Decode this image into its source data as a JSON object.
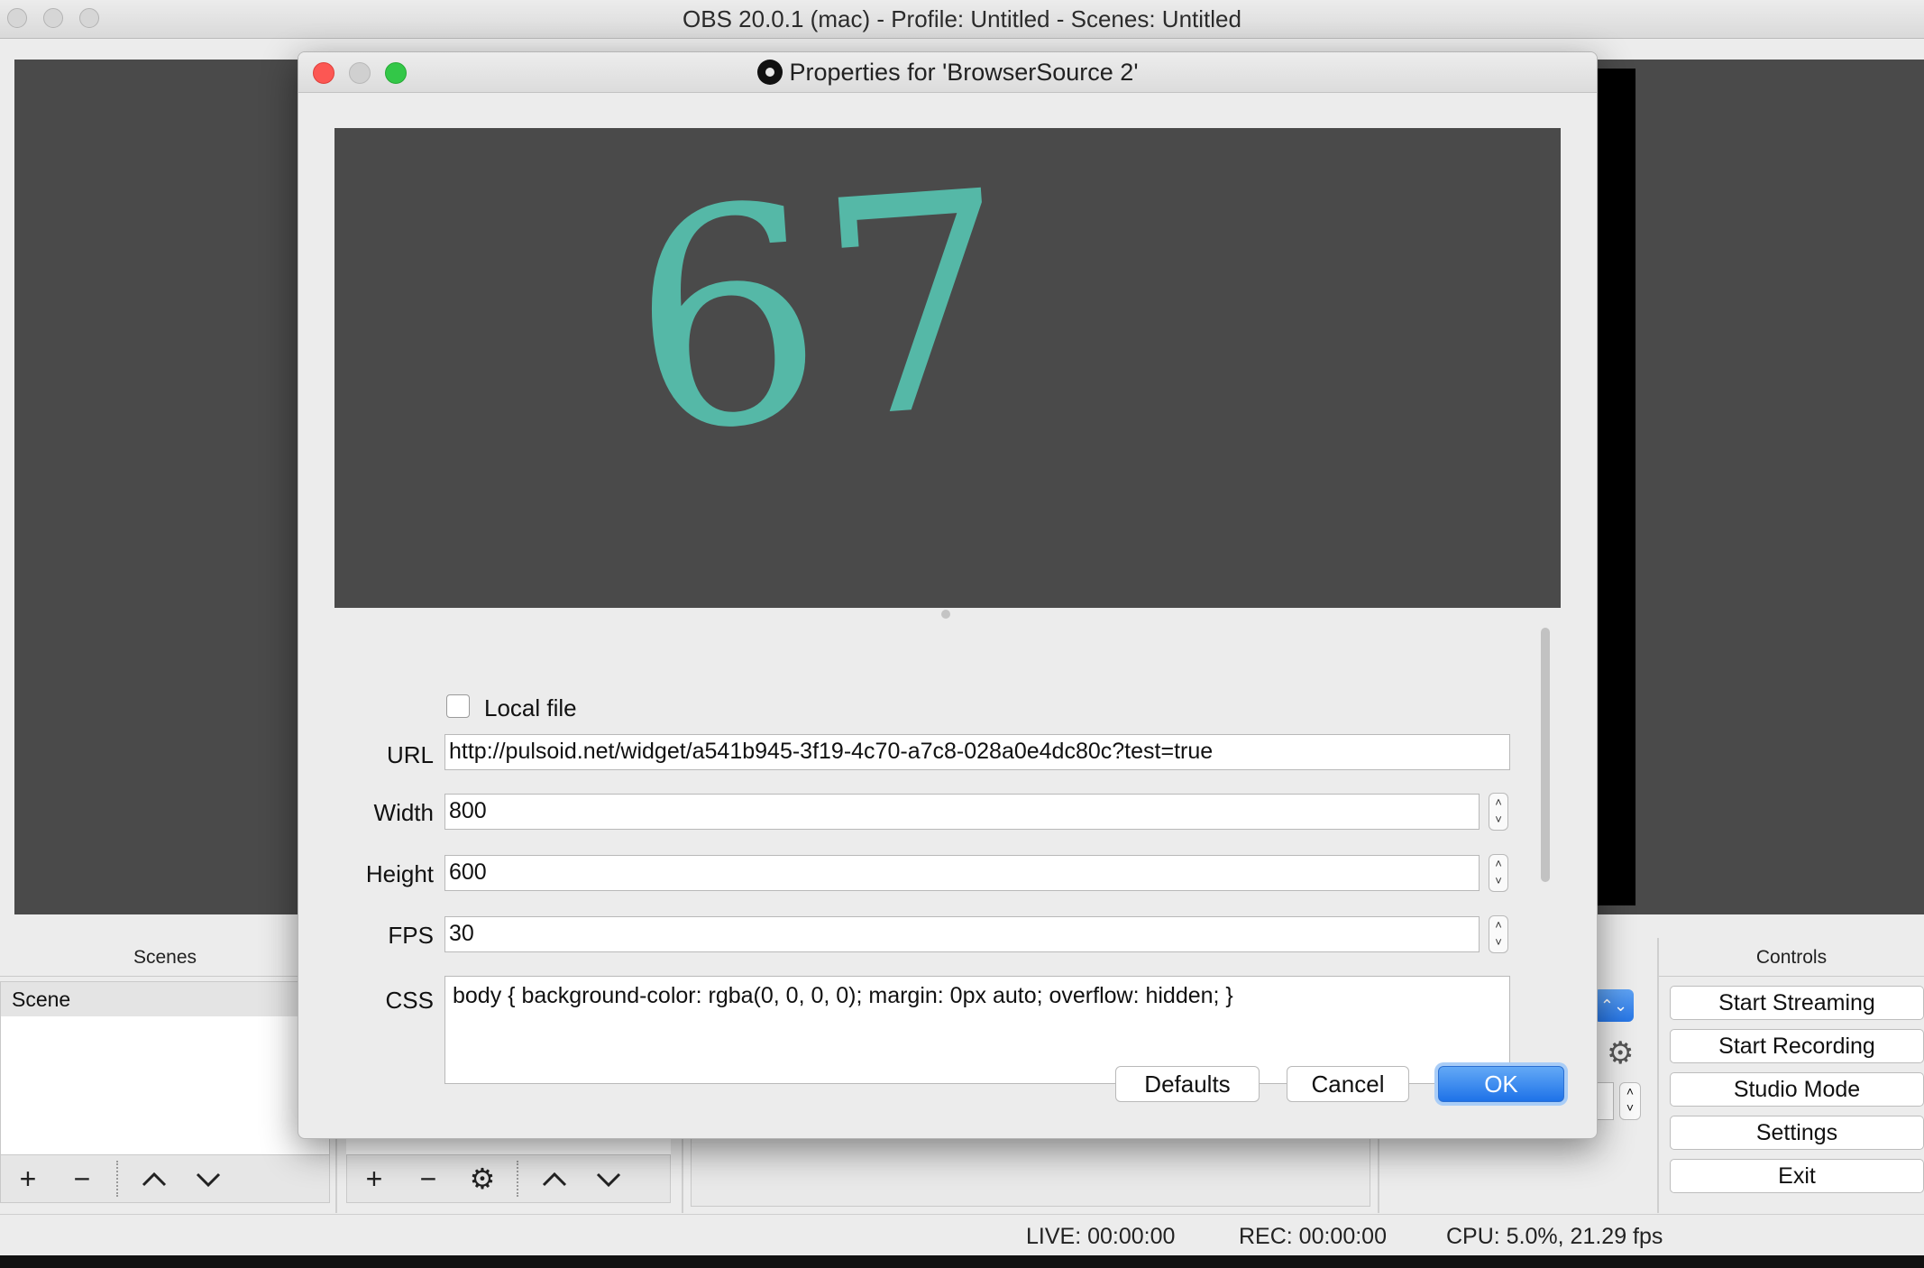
{
  "main_window": {
    "title": "OBS 20.0.1 (mac) - Profile: Untitled - Scenes: Untitled"
  },
  "docks": {
    "scenes": {
      "header": "Scenes",
      "items": [
        "Scene"
      ]
    },
    "controls": {
      "header": "Controls",
      "buttons": [
        "Start Streaming",
        "Start Recording",
        "Studio Mode",
        "Settings",
        "Exit"
      ]
    }
  },
  "toolbar_icons": [
    "plus-icon",
    "minus-icon",
    "chevron-up-icon",
    "chevron-down-icon",
    "gear-icon"
  ],
  "statusbar": {
    "live": "LIVE: 00:00:00",
    "rec": "REC: 00:00:00",
    "cpu": "CPU: 5.0%, 21.29 fps"
  },
  "dialog": {
    "title": "Properties for 'BrowserSource 2'",
    "preview": {
      "heart_rate": "67",
      "text_color": "#55b8a7",
      "background": "#4a4a4a"
    },
    "properties": {
      "local_file": {
        "label": "Local file",
        "checked": false
      },
      "url": {
        "label": "URL",
        "value": "http://pulsoid.net/widget/a541b945-3f19-4c70-a7c8-028a0e4dc80c?test=true"
      },
      "width": {
        "label": "Width",
        "value": "800"
      },
      "height": {
        "label": "Height",
        "value": "600"
      },
      "fps": {
        "label": "FPS",
        "value": "30"
      },
      "css": {
        "label": "CSS",
        "value": "body { background-color: rgba(0, 0, 0, 0); margin: 0px auto; overflow: hidden; }"
      }
    },
    "buttons": {
      "defaults": "Defaults",
      "cancel": "Cancel",
      "ok": "OK"
    }
  },
  "colors": {
    "accent_blue": "#2776e6",
    "close_red": "#fc5753",
    "minimize_gray": "#d0d0d0",
    "zoom_green": "#33c748"
  }
}
